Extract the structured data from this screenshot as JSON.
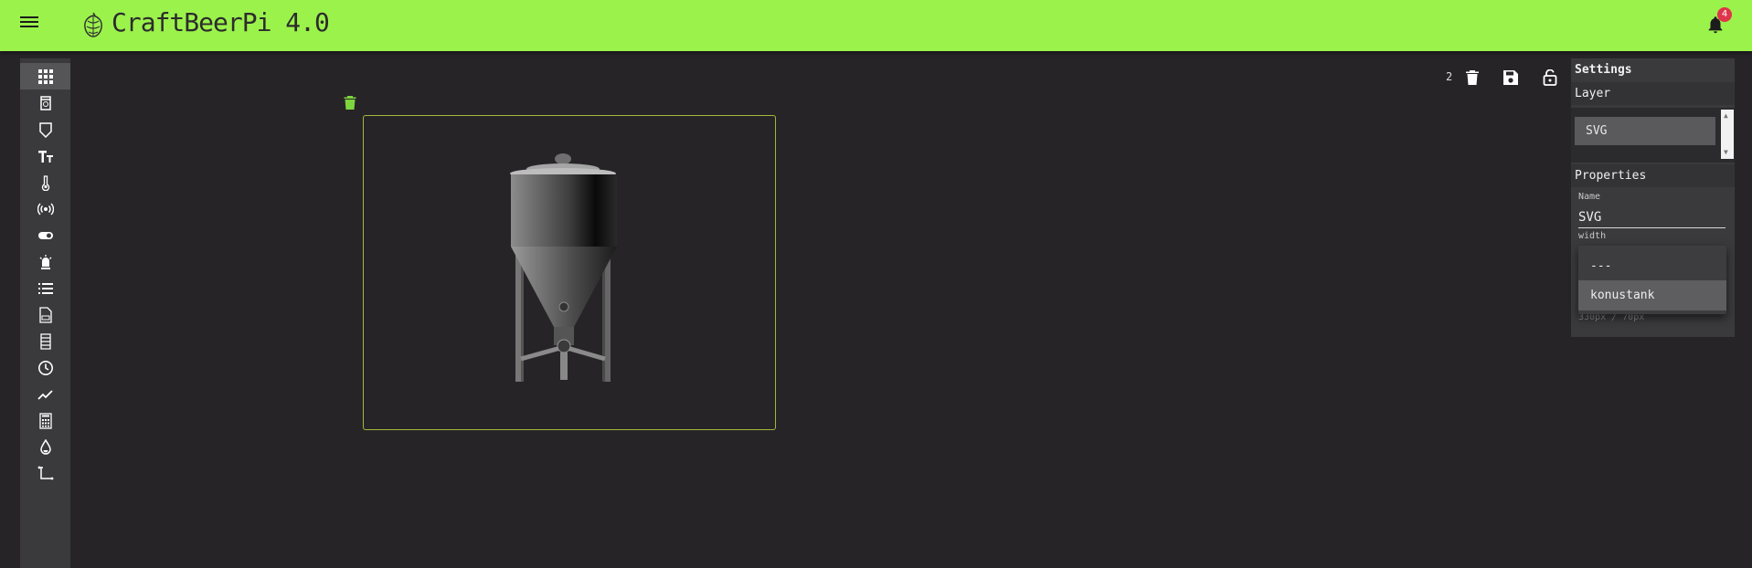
{
  "header": {
    "title": "CraftBeerPi 4.0",
    "notification_count": "4",
    "background": "#9bf24b"
  },
  "toolbar": {
    "icons": [
      "grid-icon",
      "kettle-icon",
      "fermenter-icon",
      "text-icon",
      "thermometer-icon",
      "broadcast-icon",
      "toggle-icon",
      "led-icon",
      "list-icon",
      "recipe-icon",
      "sheet-icon",
      "clock-icon",
      "chart-icon",
      "calculator-icon",
      "drop-icon",
      "path-icon"
    ]
  },
  "canvas": {
    "selection_count": "2",
    "widget": {
      "type": "svg",
      "name": "konustank"
    }
  },
  "settings": {
    "title": "Settings",
    "layer_header": "Layer",
    "layers": [
      "SVG"
    ],
    "properties_header": "Properties",
    "name_label": "Name",
    "name_value": "SVG",
    "width_label": "width",
    "size_value": "330px / 70px",
    "dropdown_options": [
      "---",
      "konustank"
    ],
    "dropdown_selected": "konustank"
  },
  "colors": {
    "accent": "#9bf24b",
    "frame": "#a2b83a",
    "badge": "#e0344a"
  }
}
